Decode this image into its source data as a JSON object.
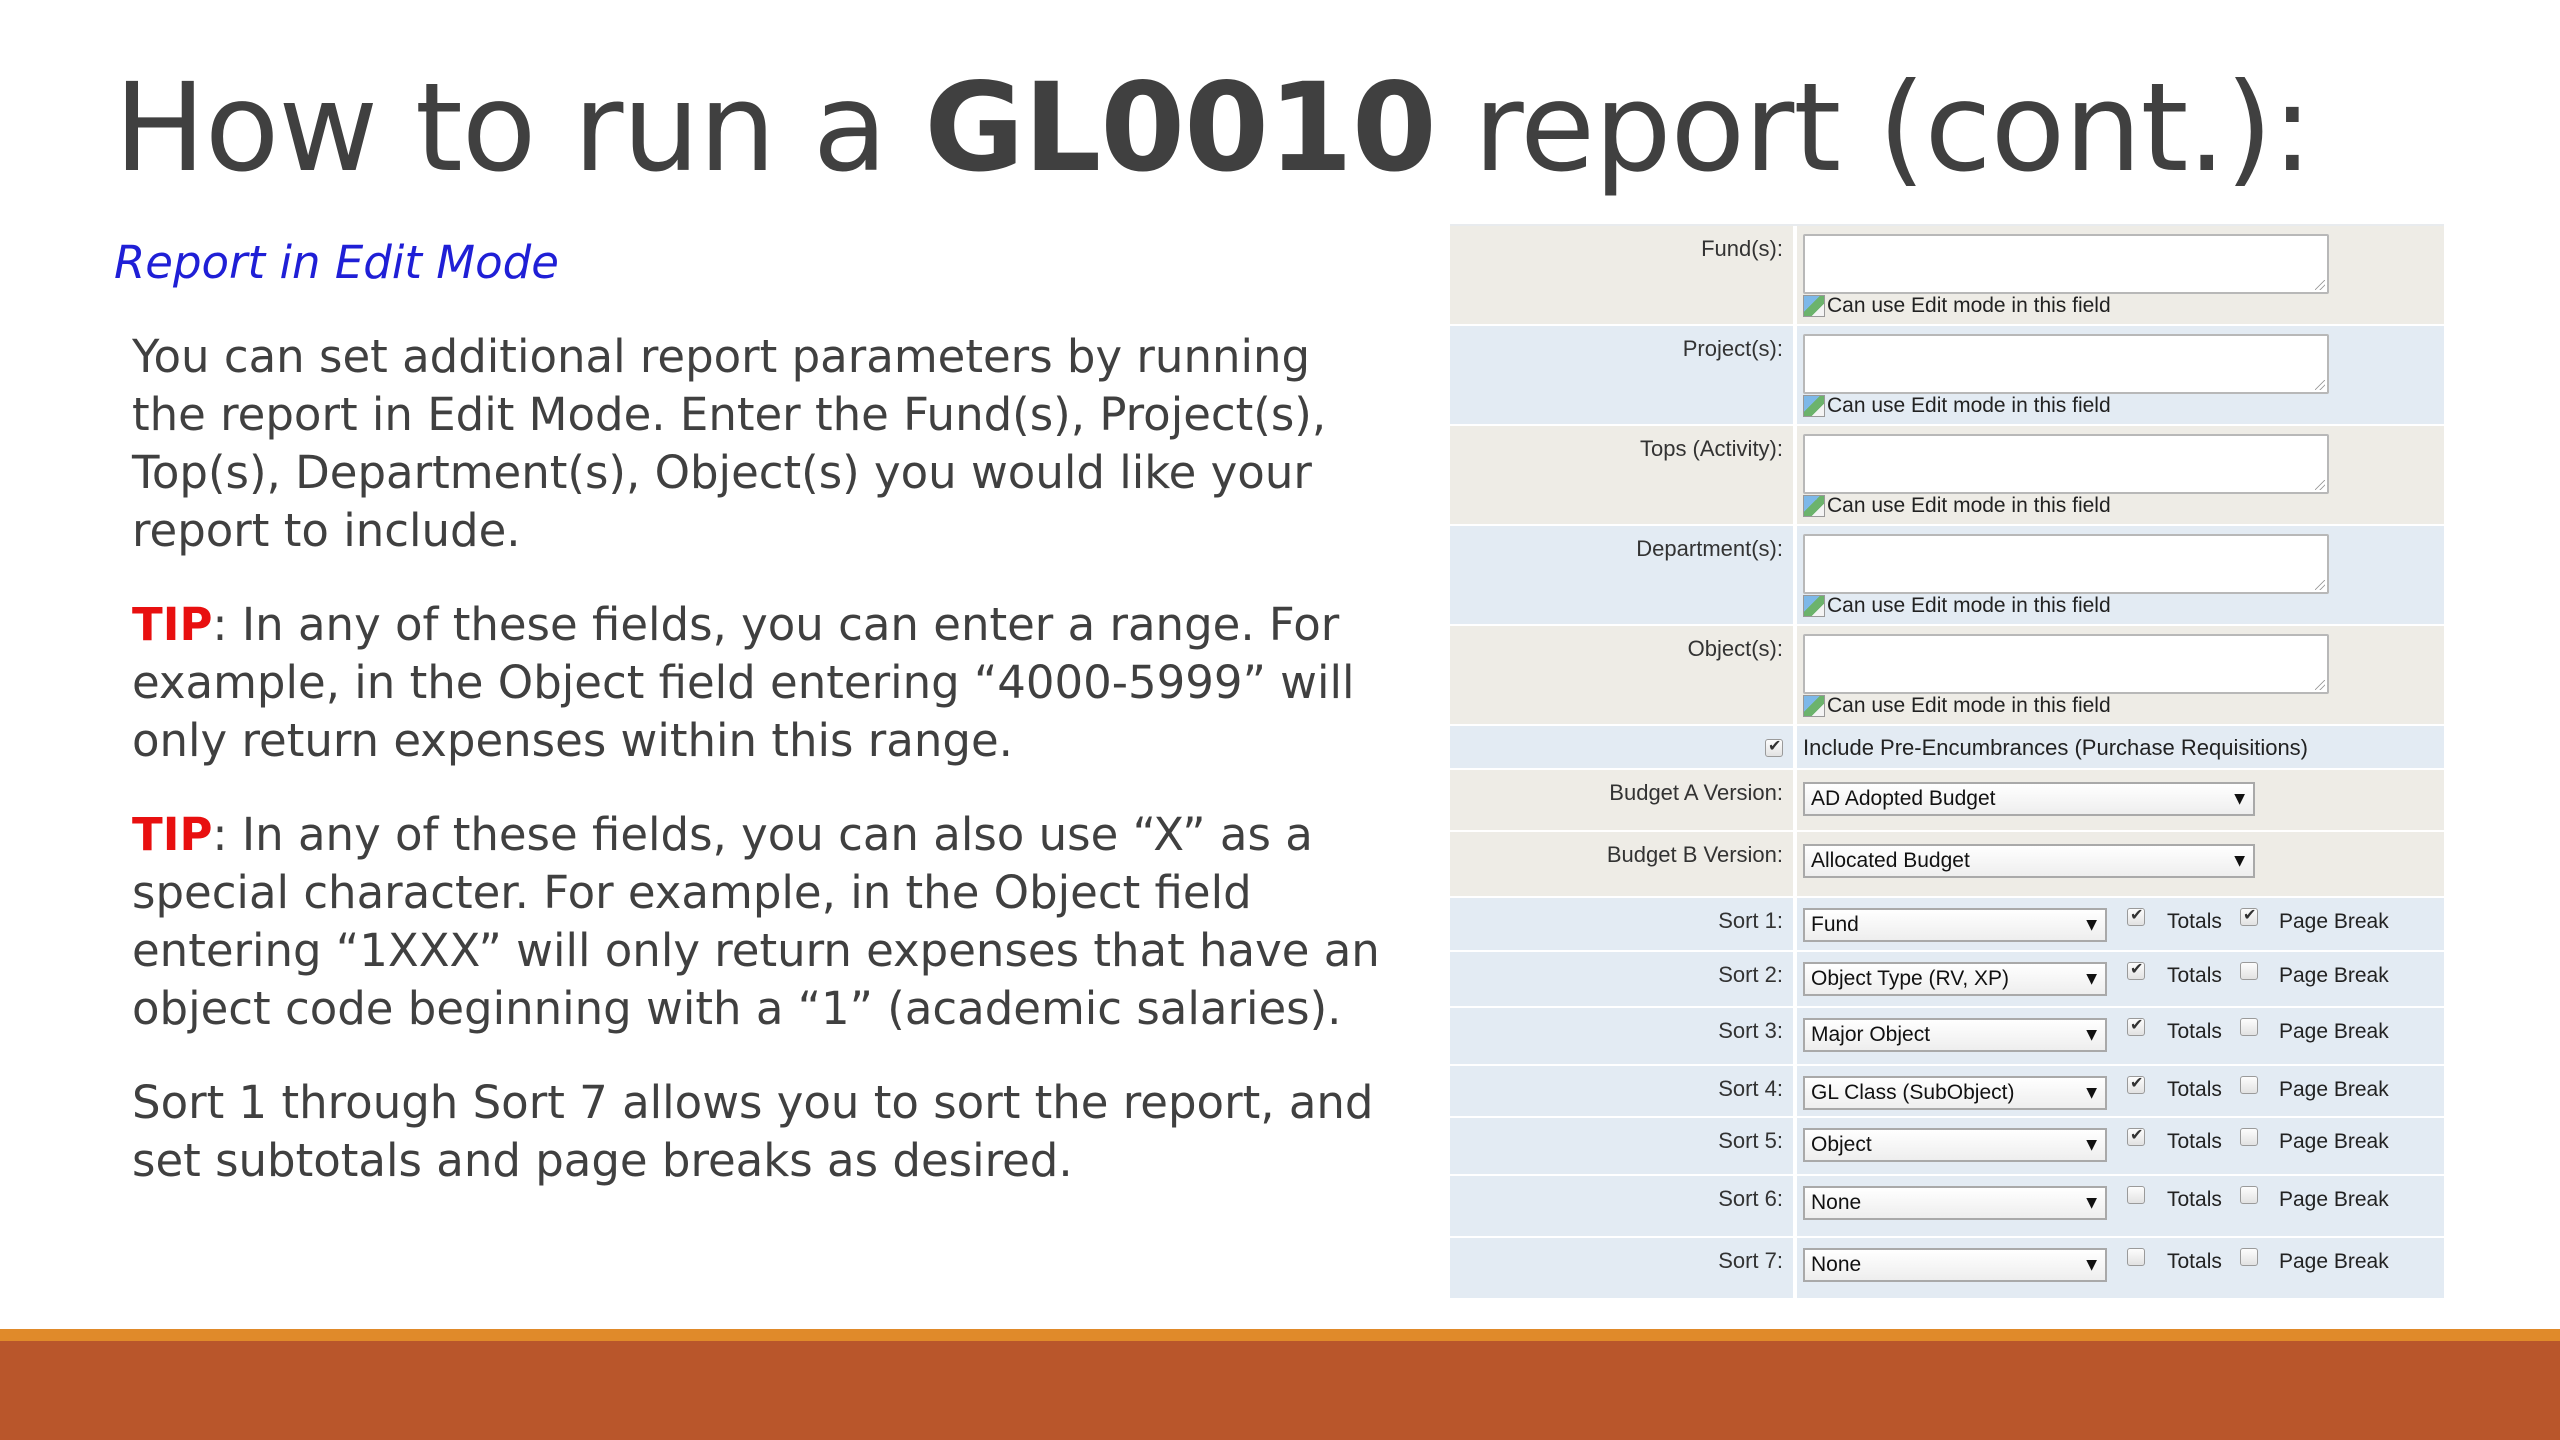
{
  "slide": {
    "title_pre": "How to run a ",
    "title_bold": "GL0010",
    "title_post": " report (cont.):",
    "subtitle": "Report in Edit Mode",
    "paragraphs": {
      "p1": "You can set additional report parameters by running the report in Edit Mode. Enter the Fund(s), Project(s), Top(s), Department(s), Object(s) you would like your report to include.",
      "tip_label": "TIP",
      "p2": ": In any of these fields, you can enter a range.  For example, in the Object field entering “4000-5999” will only return expenses within this range.",
      "p3": ": In any of these fields, you can also use “X” as a special character.  For example, in the Object field entering “1XXX” will only return expenses that have an object code beginning with a “1” (academic salaries).",
      "p4": "Sort 1 through Sort 7 allows you to sort the report, and set subtotals and page breaks as desired."
    }
  },
  "form": {
    "edit_note": "Can use Edit mode in this field",
    "fields": [
      {
        "label": "Fund(s):",
        "value": ""
      },
      {
        "label": "Project(s):",
        "value": ""
      },
      {
        "label": "Tops (Activity):",
        "value": ""
      },
      {
        "label": "Department(s):",
        "value": ""
      },
      {
        "label": "Object(s):",
        "value": ""
      }
    ],
    "pre_encumbrances": {
      "label": "Include Pre-Encumbrances (Purchase Requisitions)",
      "checked": true
    },
    "budget_a": {
      "label": "Budget A Version:",
      "value": "AD Adopted Budget"
    },
    "budget_b": {
      "label": "Budget B Version:",
      "value": "Allocated Budget"
    },
    "totals_label": "Totals",
    "page_break_label": "Page Break",
    "sorts": [
      {
        "label": "Sort 1:",
        "value": "Fund",
        "totals": true,
        "page_break": true
      },
      {
        "label": "Sort 2:",
        "value": "Object Type (RV, XP)",
        "totals": true,
        "page_break": false
      },
      {
        "label": "Sort 3:",
        "value": "Major Object",
        "totals": true,
        "page_break": false
      },
      {
        "label": "Sort 4:",
        "value": "GL Class (SubObject)",
        "totals": true,
        "page_break": false
      },
      {
        "label": "Sort 5:",
        "value": "Object",
        "totals": true,
        "page_break": false
      },
      {
        "label": "Sort 6:",
        "value": "None",
        "totals": false,
        "page_break": false
      },
      {
        "label": "Sort 7:",
        "value": "None",
        "totals": false,
        "page_break": false
      }
    ]
  },
  "colors": {
    "tip": "#e81010",
    "subtitle": "#1f1fd6",
    "footer_bar": "#b9562b",
    "footer_line": "#e08a2a"
  }
}
